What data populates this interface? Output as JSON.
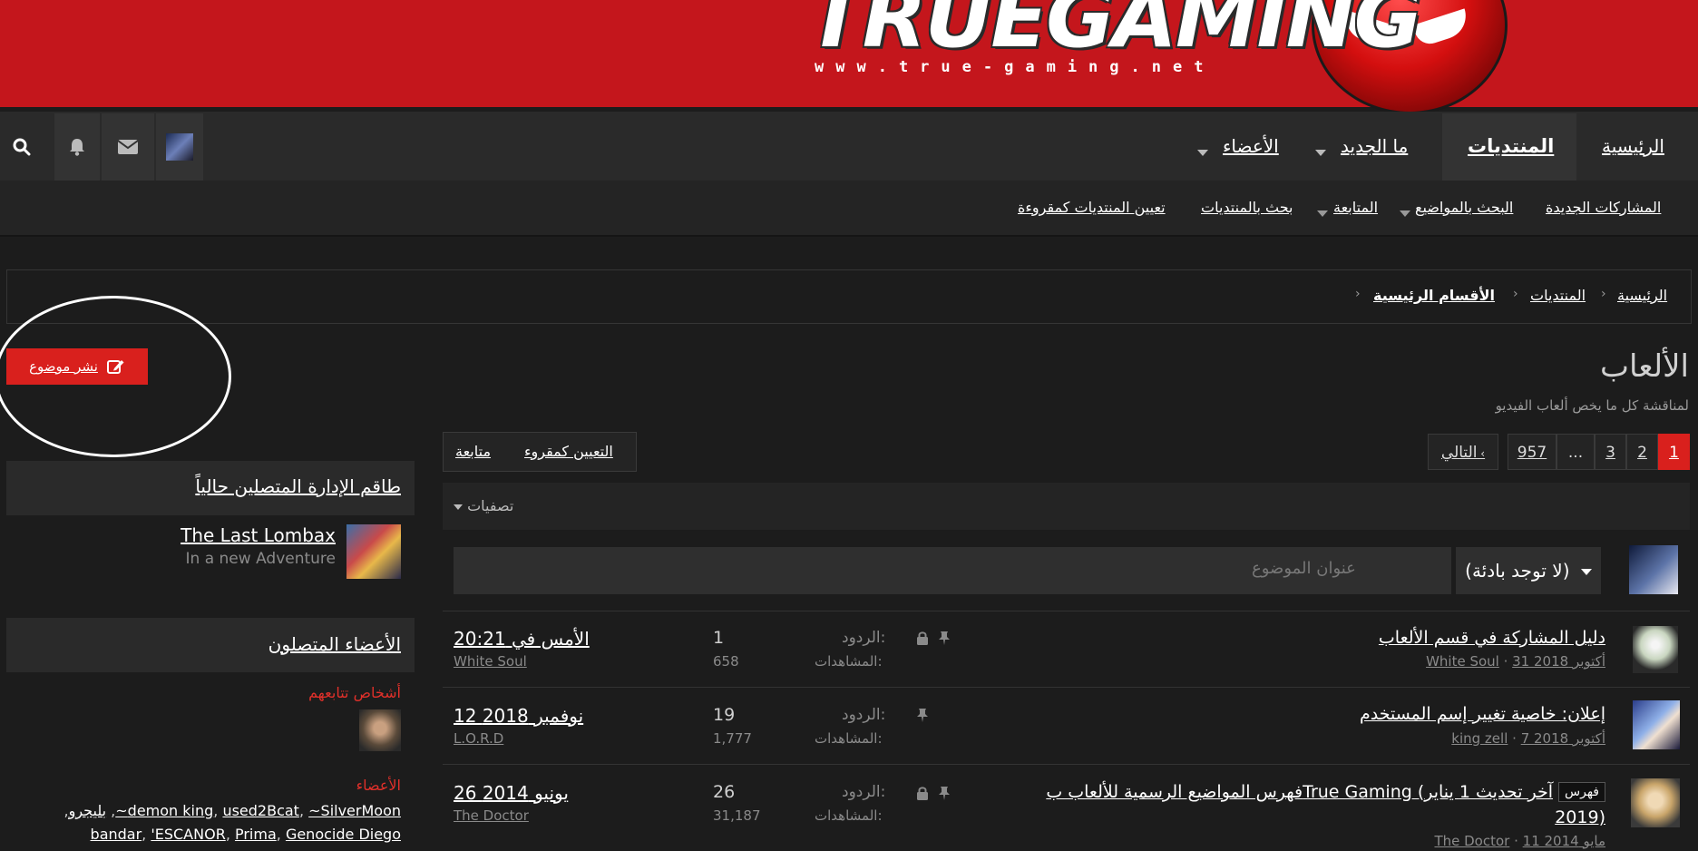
{
  "header": {
    "logo_text": "TRUEGAMING",
    "logo_url": "www.true-gaming.net"
  },
  "nav": {
    "home": "الرئيسية",
    "forums": "المنتديات",
    "whats_new": "ما الجديد",
    "members": "الأعضاء"
  },
  "subnav": {
    "new_posts": "المشاركات الجديدة",
    "search_threads": "البحث بالمواضيع",
    "watched": "المتابعة",
    "search_forums": "بحث بالمنتديات",
    "mark_read": "تعيين المنتديات كمقروءة"
  },
  "breadcrumb": {
    "home": "الرئيسية",
    "forums": "المنتديات",
    "main_sections": "الأقسام الرئيسية"
  },
  "forum": {
    "title": "الألعاب",
    "description": "لمناقشة كل ما يخص ألعاب الفيديو",
    "post_thread": "نشر موضوع"
  },
  "pagination": {
    "pages": [
      "1",
      "2",
      "3",
      "...",
      "957"
    ],
    "next": "التالي",
    "current": 1
  },
  "tabs": {
    "mark_read": "التعيين كمقروء",
    "watch": "متابعة"
  },
  "filters": {
    "label": "تصفيات"
  },
  "quick_thread": {
    "prefix": "(لا توجد بادئة)",
    "placeholder": "عنوان الموضوع"
  },
  "threads": [
    {
      "title": "دليل المشاركة في قسم الألعاب",
      "author": "White Soul",
      "date": "31 أكتوبر 2018",
      "replies_label": "الردود:",
      "views_label": "المشاهدات:",
      "replies": "1",
      "views": "658",
      "last_date": "الأمس في 20:21",
      "last_user": "White Soul",
      "locked": true,
      "sticky": true
    },
    {
      "title": "إعلان: خاصية تغيير إسم المستخدم",
      "author": "king zell",
      "date": "7 أكتوبر 2018",
      "replies_label": "الردود:",
      "views_label": "المشاهدات:",
      "replies": "19",
      "views": "1,777",
      "last_date": "12 نوفمبر 2018",
      "last_user": "L.O.R.D",
      "locked": false,
      "sticky": true
    },
    {
      "prefix": "فهرس",
      "title": "فهرس المواضيع الرسمية للألعاب بTrue Gaming (آخر تحديث 1 يناير",
      "title_line2": "2019)",
      "author": "The Doctor",
      "date": "11 مايو 2014",
      "replies_label": "الردود:",
      "views_label": "المشاهدات:",
      "replies": "26",
      "views": "31,187",
      "last_date": "26 يونيو 2014",
      "last_user": "The Doctor",
      "locked": true,
      "sticky": true
    }
  ],
  "sidebar": {
    "staff_title": "طاقم الإدارة المتصلين حالياً",
    "staff_name": "The Last Lombax",
    "staff_status": "In a new Adventure",
    "online_title": "الأعضاء المتصلون",
    "following_label": "أشخاص تتابعهم",
    "members_label": "الأعضاء",
    "members_line1": [
      "demon king",
      "used2Bcat",
      "~SilverMoon~",
      "بليجرو"
    ],
    "members_line2": [
      "bandar",
      "'ESCANOR",
      "Prima",
      "Genocide Diego"
    ]
  }
}
